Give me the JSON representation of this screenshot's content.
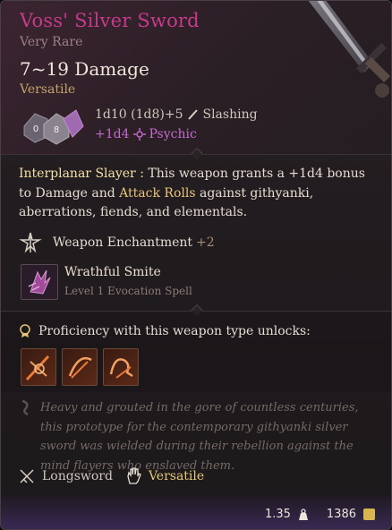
{
  "item": {
    "name": "Voss' Silver Sword",
    "rarity": "Very Rare",
    "damage_range": "7~19 Damage",
    "weapon_property": "Versatile"
  },
  "dice": {
    "formula": "1d10 (1d8)+5",
    "damage_type": "Slashing",
    "bonus": "+1d4",
    "bonus_type": "Psychic",
    "die_values": [
      "0",
      "8"
    ]
  },
  "passive": {
    "name": "Interplanar Slayer :",
    "text_1": " This weapon grants a +1d4 bonus to Damage and ",
    "highlight": "Attack Rolls",
    "text_2": " against githyanki, aberrations, fiends, and elementals."
  },
  "enchantment": {
    "label": "Weapon Enchantment",
    "value": "+2"
  },
  "spell": {
    "name": "Wrathful Smite",
    "subtitle": "Level 1 Evocation Spell"
  },
  "proficiency": {
    "label": "Proficiency with this weapon type unlocks:",
    "actions": [
      "action-1",
      "action-2",
      "action-3"
    ]
  },
  "lore": "Heavy and grouted in the gore of countless centuries, this prototype for the contemporary githyanki silver sword was wielded during their rebellion against the mind flayers who enslaved them.",
  "properties": {
    "type": "Longsword",
    "handedness": "Versatile"
  },
  "footer": {
    "weight": "1.35",
    "value": "1386"
  },
  "colors": {
    "title": "#c73a8b",
    "psychic": "#c46ad0",
    "highlight": "#e8c77a"
  }
}
